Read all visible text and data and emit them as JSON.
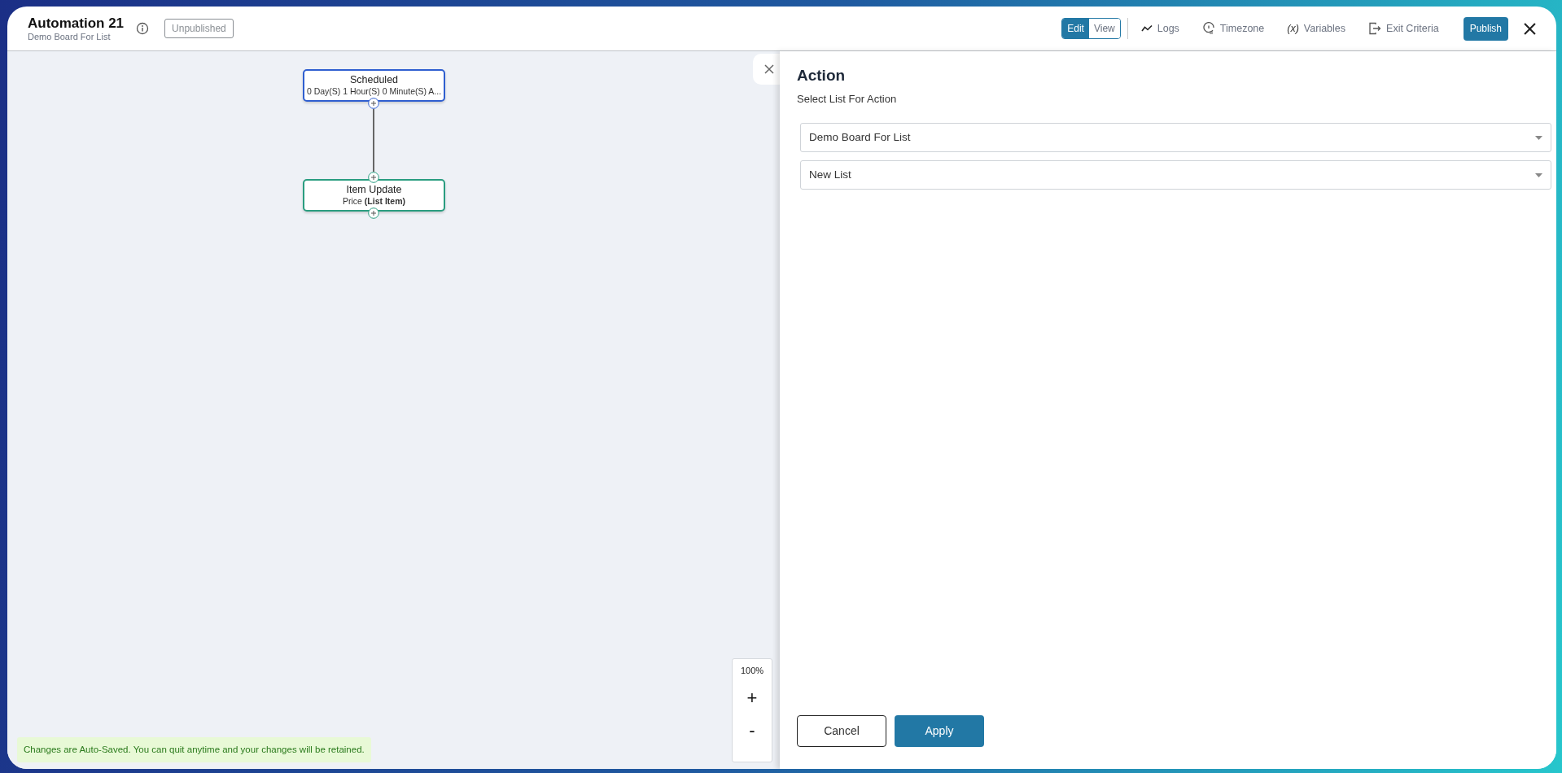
{
  "header": {
    "title": "Automation 21",
    "subtitle": "Demo Board For List",
    "status": "Unpublished"
  },
  "mode_toggle": [
    {
      "label": "Edit",
      "selected": true
    },
    {
      "label": "View",
      "selected": false
    }
  ],
  "toolbar_items": [
    {
      "kind": "logs",
      "label": "Logs"
    },
    {
      "kind": "timezone",
      "label": "Timezone"
    },
    {
      "kind": "variables",
      "label": "Variables",
      "icon_text": "(x)"
    },
    {
      "kind": "exit",
      "label": "Exit Criteria"
    }
  ],
  "publish_button": "Publish",
  "nodes": [
    {
      "title": "Scheduled",
      "detail": "0 Day(S) 1 Hour(S) 0 Minute(S) A...",
      "color": "#2f5fd0"
    },
    {
      "title": "Item Update",
      "detail": "Price **(List Item)**",
      "color": "#2a9d80"
    }
  ],
  "zoom": {
    "level": "100%",
    "zoom_in": "+",
    "zoom_out": "-"
  },
  "autosave_notice": "Changes are Auto-Saved. You can quit anytime and your changes will be retained.",
  "panel": {
    "title": "Action",
    "subtitle": "Select List For Action",
    "selects": [
      {
        "value": "Demo Board For List"
      },
      {
        "value": "New List"
      }
    ],
    "cancel_button": "Cancel",
    "apply_button": "Apply"
  }
}
